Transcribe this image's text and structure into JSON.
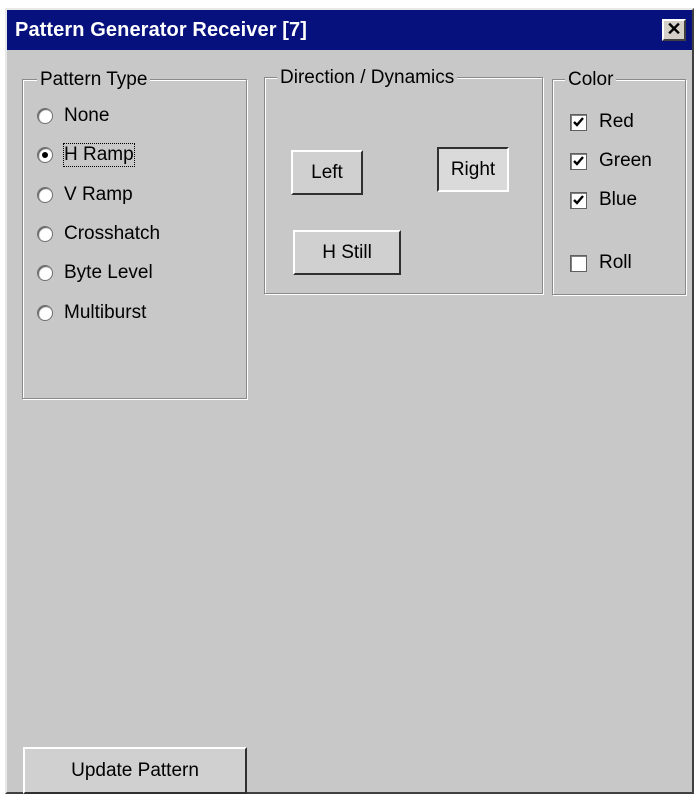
{
  "window": {
    "title": "Pattern Generator Receiver [7]",
    "close_glyph": "✕"
  },
  "pattern_type": {
    "legend": "Pattern Type",
    "selected": "H Ramp",
    "options": [
      {
        "label": "None",
        "selected": false
      },
      {
        "label": "H Ramp",
        "selected": true
      },
      {
        "label": "V Ramp",
        "selected": false
      },
      {
        "label": "Crosshatch",
        "selected": false
      },
      {
        "label": "Byte Level",
        "selected": false
      },
      {
        "label": "Multiburst",
        "selected": false
      }
    ]
  },
  "direction": {
    "legend": "Direction / Dynamics",
    "left_label": "Left",
    "right_label": "Right",
    "right_pressed": true,
    "hstill_label": "H Still"
  },
  "color": {
    "legend": "Color",
    "items": [
      {
        "label": "Red",
        "checked": true
      },
      {
        "label": "Green",
        "checked": true
      },
      {
        "label": "Blue",
        "checked": true
      },
      {
        "label": "Roll",
        "checked": false
      }
    ]
  },
  "footer": {
    "update_label": "Update Pattern"
  },
  "colors": {
    "titlebar": "#07117e",
    "face": "#c8c8c8"
  }
}
